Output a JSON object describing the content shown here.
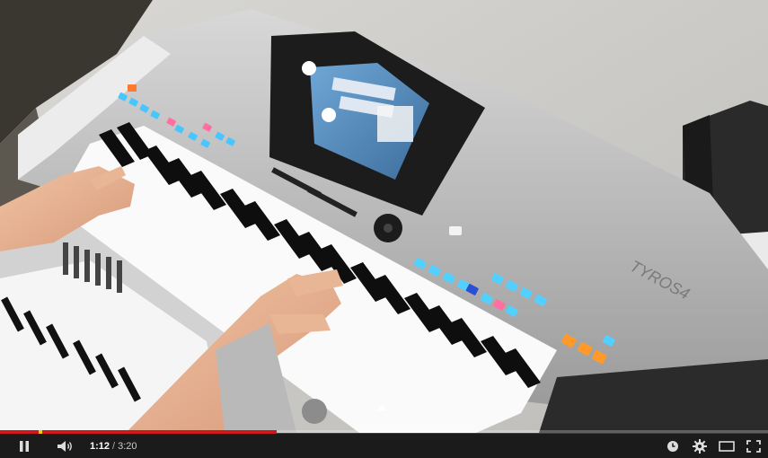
{
  "player": {
    "time_current": "1:12",
    "time_separator": "/",
    "time_total": "3:20",
    "progress_fraction": 0.36,
    "accent_color": "#cc181e",
    "controls": {
      "play_pause_icon": "pause-icon",
      "volume_icon": "volume-icon",
      "watch_later_icon": "clock-icon",
      "settings_icon": "gear-icon",
      "size_icon": "theater-mode-icon",
      "fullscreen_icon": "fullscreen-icon"
    }
  },
  "video": {
    "subject": "Yamaha Tyros4 keyboard being played",
    "keyboard_brand_text": "TYROS4"
  }
}
